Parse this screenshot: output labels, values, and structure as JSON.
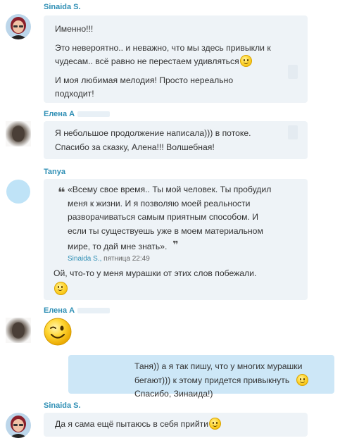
{
  "messages": [
    {
      "author": "Sinaida S.",
      "lines": [
        "Именно!!!",
        "Это невероятно.. и неважно, что мы здесь привыкли к чудесам.. всё равно не перестаем удивляться",
        "И моя любимая мелодия! Просто нереально подходит!"
      ]
    },
    {
      "author": "Елена А",
      "lines": [
        "Я небольшое продолжение написала))) в потоке. Спасибо за сказку, Алена!!! Волшебная!"
      ]
    },
    {
      "author": "Tanya",
      "quote": {
        "text": "«Всему свое время.. Ты мой человек. Ты пробудил меня к жизни. И я позволяю моей реальности разворачиваться самым приятным способом. И если ты существуешь уже в моем материальном мире, то дай мне знать».",
        "source": "Sinaida S.,",
        "time": "пятница 22:49"
      },
      "lines": [
        "Ой, что-то у меня мурашки от этих слов побежали."
      ]
    },
    {
      "author": "Елена А",
      "emoticon": "wink-emoticon"
    },
    {
      "author": "",
      "outgoing": true,
      "lines": [
        "Таня)) а я так пишу, что у многих мурашки бегают))) к этому придется привыкнуть",
        "Спасибо, Зинаида!)"
      ]
    },
    {
      "author": "Sinaida S.",
      "lines": [
        "Да я сама ещё пытаюсь в себя прийти"
      ]
    }
  ],
  "colors": {
    "name": "#2f8fb5",
    "bubble_in": "#eef3f7",
    "bubble_out": "#cde7f7",
    "text": "#333333"
  },
  "icons": [
    "smile-emoticon",
    "wink-emoticon",
    "quote-open-icon",
    "quote-close-icon"
  ]
}
